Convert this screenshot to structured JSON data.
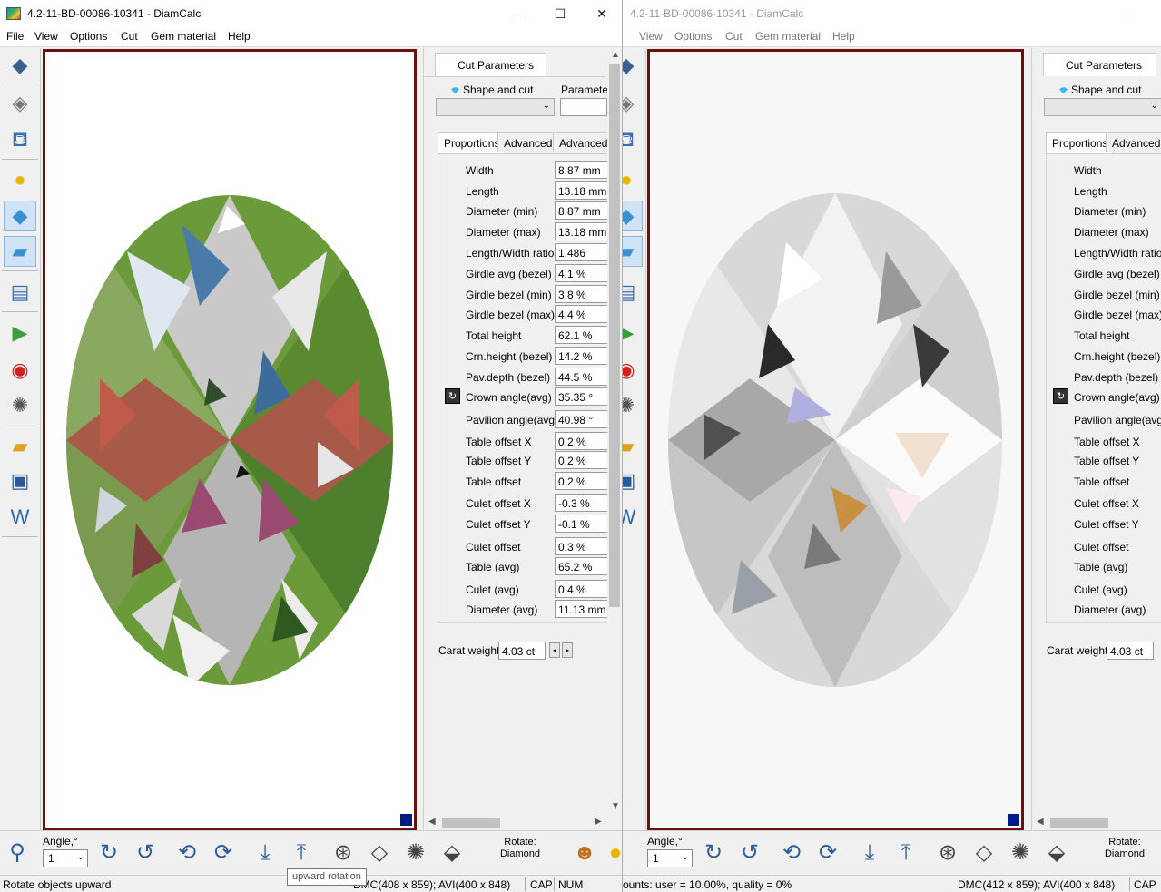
{
  "left_window": {
    "title": "4.2-11-BD-00086-10341 - DiamCalc",
    "controls": {
      "minimize": "—",
      "maximize": "☐",
      "close": "✕"
    },
    "menu": [
      "File",
      "View",
      "Options",
      "Cut",
      "Gem material",
      "Help"
    ],
    "panel": {
      "tab_label": "Cut Parameters",
      "shape_label": "Shape and cut",
      "parameters_label": "Parameters",
      "subtabs": [
        "Proportions",
        "Advanced",
        "Advanced ."
      ],
      "properties": [
        {
          "label": "Width",
          "value": "8.87 mm"
        },
        {
          "label": "Length",
          "value": "13.18 mm"
        },
        {
          "label": "Diameter (min)",
          "value": "8.87 mm"
        },
        {
          "label": "Diameter (max)",
          "value": "13.18 mm"
        },
        {
          "label": "Length/Width ratio",
          "value": "1.486"
        },
        {
          "label": "Girdle avg (bezel)",
          "value": "4.1 %"
        },
        {
          "label": "Girdle bezel (min)",
          "value": "3.8 %"
        },
        {
          "label": "Girdle bezel (max)",
          "value": "4.4 %"
        },
        {
          "label": "Total height",
          "value": "62.1 %"
        },
        {
          "label": "Crn.height (bezel)",
          "value": "14.2 %"
        },
        {
          "label": "Pav.depth (bezel)",
          "value": "44.5 %"
        },
        {
          "label": "Crown angle(avg)",
          "value": "35.35 °"
        },
        {
          "label": "Pavilion angle(avg)",
          "value": "40.98 °"
        },
        {
          "label": "Table offset X",
          "value": "0.2 %"
        },
        {
          "label": "Table offset Y",
          "value": "0.2 %"
        },
        {
          "label": "Table offset",
          "value": "0.2 %"
        },
        {
          "label": "Culet offset X",
          "value": "-0.3 %"
        },
        {
          "label": "Culet offset Y",
          "value": "-0.1 %"
        },
        {
          "label": "Culet offset",
          "value": "0.3 %"
        },
        {
          "label": "Table (avg)",
          "value": "65.2 %"
        },
        {
          "label": "Culet (avg)",
          "value": "0.4 %"
        },
        {
          "label": "Diameter (avg)",
          "value": "11.13 mm"
        }
      ],
      "carat_label": "Carat weight",
      "carat_value": "4.03 ct"
    },
    "bottom": {
      "angle_label": "Angle,°",
      "angle_value": "1",
      "rotate_label_line1": "Rotate:",
      "rotate_label_line2": "Diamond"
    },
    "status": {
      "message": "Rotate objects upward",
      "dmc": "DMC(408 x 859); AVI(400 x 848)",
      "cap": "CAP",
      "num": "NUM"
    },
    "tooltip": "upward rotation"
  },
  "right_window": {
    "title": "4.2-11-BD-00086-10341 - DiamCalc",
    "controls": {
      "minimize": "—"
    },
    "menu": [
      "View",
      "Options",
      "Cut",
      "Gem material",
      "Help"
    ],
    "panel": {
      "tab_label": "Cut Parameters",
      "shape_label": "Shape and cut",
      "subtabs": [
        "Proportions",
        "Advanced"
      ],
      "labels": [
        "Width",
        "Length",
        "Diameter (min)",
        "Diameter (max)",
        "Length/Width ratio",
        "Girdle avg (bezel)",
        "Girdle bezel (min)",
        "Girdle bezel (max)",
        "Total height",
        "Crn.height (bezel)",
        "Pav.depth (bezel)",
        "Crown angle(avg)",
        "Pavilion angle(avg)",
        "Table offset X",
        "Table offset Y",
        "Table offset",
        "Culet offset X",
        "Culet offset Y",
        "Culet offset",
        "Table (avg)",
        "Culet (avg)",
        "Diameter (avg)"
      ],
      "carat_label": "Carat weight",
      "carat_value": "4.03 ct"
    },
    "bottom": {
      "angle_label": "Angle,°",
      "angle_value": "1",
      "rotate_label_line1": "Rotate:",
      "rotate_label_line2": "Diamond"
    },
    "status": {
      "counts": "ounts: user = 10.00%, quality = 0%",
      "dmc": "DMC(412 x 859); AVI(400 x 848)",
      "cap": "CAP"
    }
  },
  "colors": {
    "viewport_border": "#6b0f0f",
    "corner_marker": "#001a8c",
    "facet_green": "#6a9a3a",
    "facet_red": "#a85a48"
  }
}
